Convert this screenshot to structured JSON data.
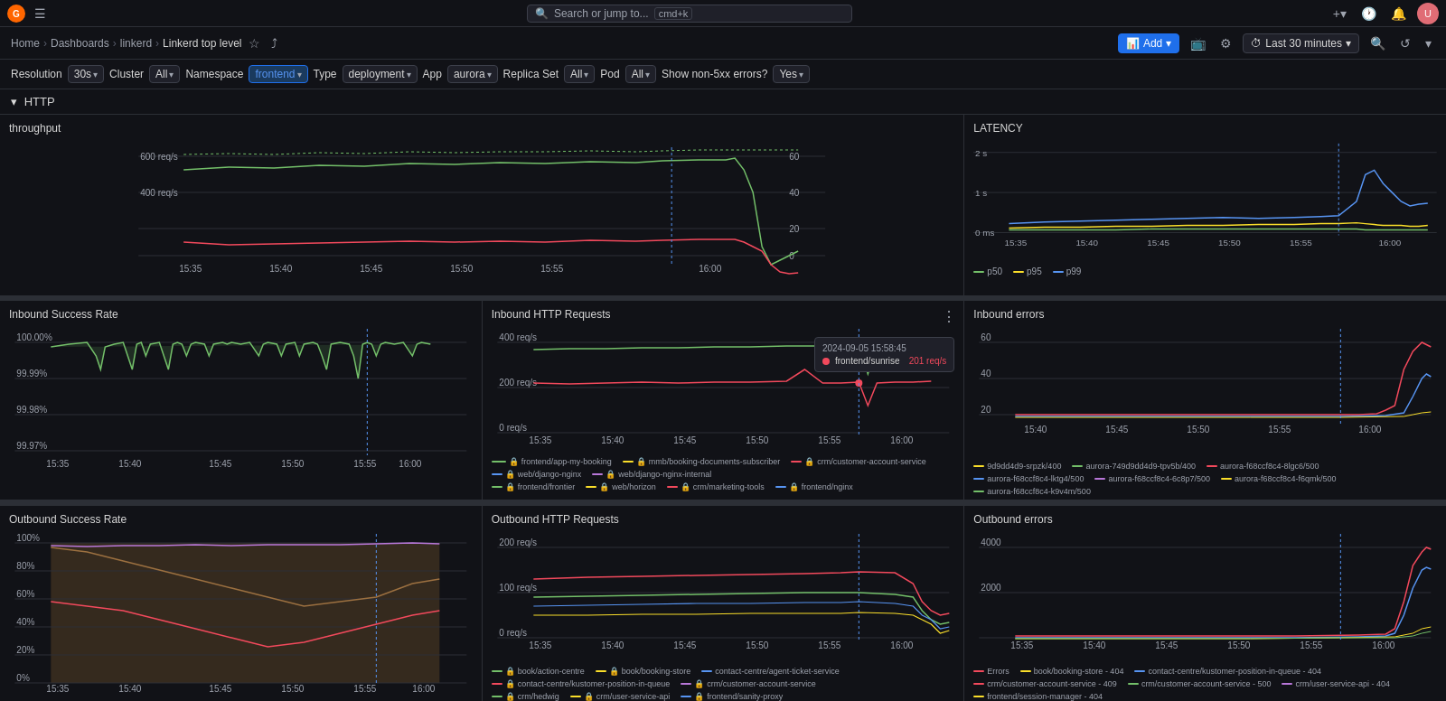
{
  "topbar": {
    "search_placeholder": "Search or jump to...",
    "search_shortcut": "cmd+k",
    "logo": "G"
  },
  "nav": {
    "breadcrumbs": [
      "Home",
      "Dashboards",
      "linkerd",
      "Linkerd top level"
    ],
    "add_label": "Add",
    "time_range": "Last 30 minutes",
    "star_icon": "★",
    "share_icon": "⤴"
  },
  "filters": {
    "resolution_label": "Resolution",
    "resolution_value": "30s",
    "cluster_label": "Cluster",
    "cluster_value": "All",
    "namespace_label": "Namespace",
    "namespace_value": "frontend",
    "type_label": "Type",
    "type_value": "deployment",
    "app_label": "App",
    "app_value": "aurora",
    "replica_set_label": "Replica Set",
    "replica_set_value": "All",
    "pod_label": "Pod",
    "pod_value": "All",
    "show_errors_label": "Show non-5xx errors?",
    "show_errors_value": "Yes"
  },
  "section": {
    "http_label": "HTTP"
  },
  "panels": {
    "throughput": {
      "title": "throughput",
      "y_labels": [
        "60",
        "40",
        "20",
        "0",
        "600 req/s",
        "400 req/s"
      ]
    },
    "latency": {
      "title": "LATENCY",
      "y_labels": [
        "2 s",
        "1 s",
        "0 ms"
      ],
      "legend": [
        {
          "label": "p50",
          "color": "#73bf69"
        },
        {
          "label": "p95",
          "color": "#fade2a"
        },
        {
          "label": "p99",
          "color": "#5794f2"
        }
      ]
    },
    "inbound_success_rate": {
      "title": "Inbound Success Rate",
      "y_labels": [
        "100.00%",
        "99.99%",
        "99.98%",
        "99.97%"
      ]
    },
    "inbound_http": {
      "title": "Inbound HTTP Requests",
      "y_labels": [
        "400 req/s",
        "200 req/s",
        "0 req/s"
      ],
      "tooltip": {
        "time": "2024-09-05 15:58:45",
        "label": "frontend/sunrise",
        "value": "201 req/s"
      },
      "legend": [
        {
          "label": "frontend/app-my-booking",
          "color": "#73bf69"
        },
        {
          "label": "mmb/booking-documents-subscriber",
          "color": "#fade2a"
        },
        {
          "label": "crm/customer-account-service",
          "color": "#f2495c"
        },
        {
          "label": "web/django-nginx",
          "color": "#5794f2"
        },
        {
          "label": "web/django-nginx-internal",
          "color": "#b877d9"
        },
        {
          "label": "frontend/frontier",
          "color": "#73bf69"
        },
        {
          "label": "web/horizon",
          "color": "#fade2a"
        },
        {
          "label": "crm/marketing-tools",
          "color": "#f2495c"
        },
        {
          "label": "frontend/nginx",
          "color": "#5794f2"
        }
      ]
    },
    "inbound_errors": {
      "title": "Inbound errors",
      "y_labels": [
        "60",
        "40",
        "20"
      ],
      "legend": [
        {
          "label": "9d9dd4d9-srpzk/400",
          "color": "#fade2a"
        },
        {
          "label": "aurora-749d9dd4d9-tpv5b/400",
          "color": "#73bf69"
        },
        {
          "label": "aurora-f68ccf8c4-8lgc6/500",
          "color": "#f2495c"
        },
        {
          "label": "aurora-f68ccf8c4-lktg4/500",
          "color": "#5794f2"
        },
        {
          "label": "aurora-f68ccf8c4-6c8p7/500",
          "color": "#b877d9"
        },
        {
          "label": "aurora-f68ccf8c4-f6qmk/500",
          "color": "#fade2a"
        },
        {
          "label": "aurora-f68ccf8c4-k9v4m/500",
          "color": "#73bf69"
        }
      ]
    },
    "outbound_success_rate": {
      "title": "Outbound Success Rate",
      "y_labels": [
        "100%",
        "80%",
        "60%",
        "40%",
        "20%",
        "0%"
      ]
    },
    "outbound_http": {
      "title": "Outbound HTTP Requests",
      "y_labels": [
        "200 req/s",
        "100 req/s",
        "0 req/s"
      ],
      "legend": [
        {
          "label": "book/action-centre",
          "color": "#73bf69"
        },
        {
          "label": "book/booking-store",
          "color": "#fade2a"
        },
        {
          "label": "contact-centre/agent-ticket-service",
          "color": "#5794f2"
        },
        {
          "label": "contact-centre/kustomer-position-in-queue",
          "color": "#f2495c"
        },
        {
          "label": "crm/customer-account-service",
          "color": "#b877d9"
        },
        {
          "label": "crm/hedwig",
          "color": "#73bf69"
        },
        {
          "label": "crm/user-service-api",
          "color": "#fade2a"
        },
        {
          "label": "frontend/sanity-proxy",
          "color": "#5794f2"
        }
      ]
    },
    "outbound_errors": {
      "title": "Outbound errors",
      "y_labels": [
        "4000",
        "2000"
      ],
      "legend": [
        {
          "label": "Errors",
          "color": "#f2495c"
        },
        {
          "label": "book/booking-store - 404",
          "color": "#fade2a"
        },
        {
          "label": "contact-centre/kustomer-position-in-queue - 404",
          "color": "#5794f2"
        },
        {
          "label": "crm/customer-account-service - 409",
          "color": "#f2495c"
        },
        {
          "label": "crm/customer-account-service - 500",
          "color": "#73bf69"
        },
        {
          "label": "crm/user-service-api - 404",
          "color": "#b877d9"
        },
        {
          "label": "frontend/session-manager - 404",
          "color": "#fade2a"
        }
      ]
    }
  },
  "x_labels": [
    "15:35",
    "15:40",
    "15:45",
    "15:50",
    "15:55",
    "16:00"
  ],
  "x_labels_short": [
    "15:40",
    "15:45",
    "15:50",
    "15:55",
    "16:00"
  ]
}
